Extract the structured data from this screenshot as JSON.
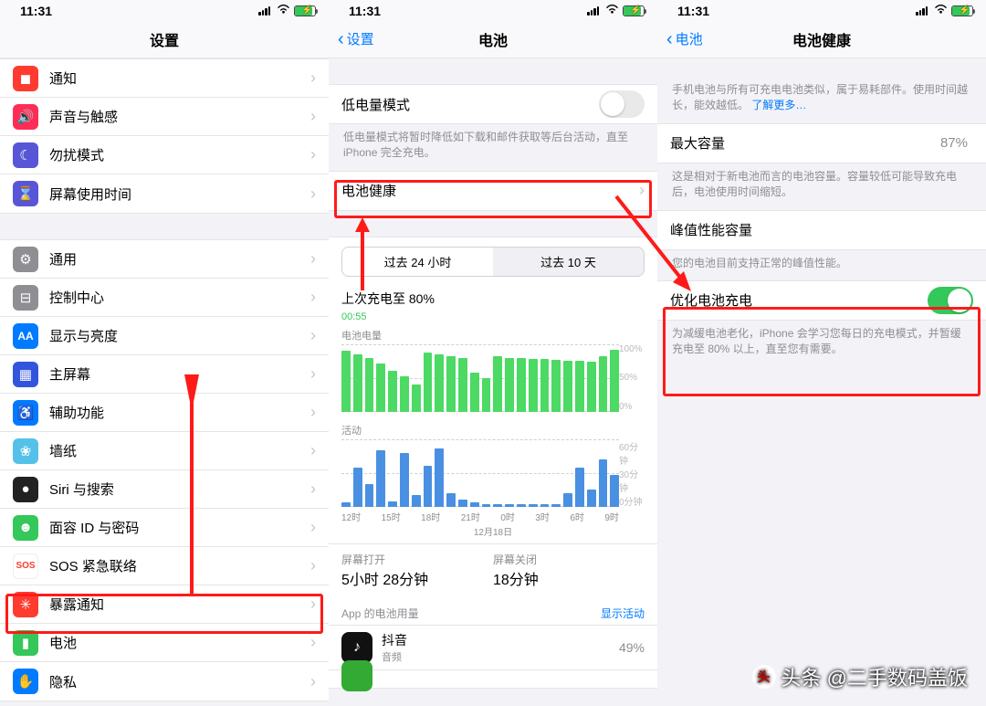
{
  "status": {
    "time": "11:31"
  },
  "s1": {
    "title": "设置",
    "section1": [
      {
        "label": "通知",
        "color": "#ff3b30",
        "glyph": "◼︎"
      },
      {
        "label": "声音与触感",
        "color": "#ff2d55",
        "glyph": "🔊"
      },
      {
        "label": "勿扰模式",
        "color": "#5856d6",
        "glyph": "☾"
      },
      {
        "label": "屏幕使用时间",
        "color": "#5856d6",
        "glyph": "⌛"
      }
    ],
    "section2": [
      {
        "label": "通用",
        "color": "#8e8e93",
        "glyph": "⚙"
      },
      {
        "label": "控制中心",
        "color": "#8e8e93",
        "glyph": "⊟"
      },
      {
        "label": "显示与亮度",
        "color": "#007aff",
        "glyph": "AA"
      },
      {
        "label": "主屏幕",
        "color": "#3355dd",
        "glyph": "▦"
      },
      {
        "label": "辅助功能",
        "color": "#007aff",
        "glyph": "♿"
      },
      {
        "label": "墙纸",
        "color": "#55c1e8",
        "glyph": "❀"
      },
      {
        "label": "Siri 与搜索",
        "color": "#222",
        "glyph": "●"
      },
      {
        "label": "面容 ID 与密码",
        "color": "#34c759",
        "glyph": "☻"
      },
      {
        "label": "SOS 紧急联络",
        "color": "#ffffff",
        "glyph": "SOS"
      },
      {
        "label": "暴露通知",
        "color": "#ff3b30",
        "glyph": "✳"
      },
      {
        "label": "电池",
        "color": "#34c759",
        "glyph": "▮"
      },
      {
        "label": "隐私",
        "color": "#007aff",
        "glyph": "✋"
      }
    ]
  },
  "s2": {
    "back": "设置",
    "title": "电池",
    "low_power": "低电量模式",
    "low_power_note": "低电量模式将暂时降低如下载和邮件获取等后台活动，直至 iPhone 完全充电。",
    "battery_health": "电池健康",
    "seg": {
      "a": "过去 24 小时",
      "b": "过去 10 天"
    },
    "last_charge": "上次充电至 80%",
    "last_charge_time": "00:55",
    "level_label": "电池电量",
    "activity_label": "活动",
    "ylabels_pct": [
      "100%",
      "50%",
      "0%"
    ],
    "ylabels_min": [
      "60分钟",
      "30分钟",
      "0分钟"
    ],
    "xaxis": [
      "12时",
      "15时",
      "18时",
      "21时",
      "0时",
      "3时",
      "6时",
      "9时"
    ],
    "xdate": "12月18日",
    "screen_on_k": "屏幕打开",
    "screen_on_v": "5小时 28分钟",
    "screen_off_k": "屏幕关闭",
    "screen_off_v": "18分钟",
    "apps_header": "App 的电池用量",
    "show_activity": "显示活动",
    "app1": {
      "name": "抖音",
      "sub": "音频",
      "pct": "49%"
    }
  },
  "s3": {
    "back": "电池",
    "title": "电池健康",
    "intro": "手机电池与所有可充电电池类似，属于易耗部件。使用时间越长，能效越低。",
    "learn_more": "了解更多…",
    "max_cap": "最大容量",
    "max_cap_val": "87%",
    "max_cap_note": "这是相对于新电池而言的电池容量。容量较低可能导致充电后，电池使用时间缩短。",
    "peak": "峰值性能容量",
    "peak_note": "您的电池目前支持正常的峰值性能。",
    "opt_title": "优化电池充电",
    "opt_note": "为减缓电池老化，iPhone 会学习您每日的充电模式，并暂缓充电至 80% 以上，直至您有需要。"
  },
  "watermark": "头条 @二手数码盖饭",
  "chart_data": [
    {
      "type": "bar",
      "title": "电池电量",
      "ylabel": "%",
      "ylim": [
        0,
        100
      ],
      "x": [
        "12",
        "13",
        "14",
        "15",
        "16",
        "17",
        "18",
        "19",
        "20",
        "21",
        "22",
        "23",
        "0",
        "1",
        "2",
        "3",
        "4",
        "5",
        "6",
        "7",
        "8",
        "9",
        "10",
        "11"
      ],
      "values": [
        90,
        85,
        80,
        72,
        60,
        52,
        40,
        88,
        85,
        82,
        80,
        58,
        50,
        82,
        80,
        79,
        78,
        78,
        77,
        76,
        75,
        74,
        82,
        92
      ]
    },
    {
      "type": "bar",
      "title": "活动",
      "ylabel": "分钟",
      "ylim": [
        0,
        60
      ],
      "x": [
        "12",
        "13",
        "14",
        "15",
        "16",
        "17",
        "18",
        "19",
        "20",
        "21",
        "22",
        "23",
        "0",
        "1",
        "2",
        "3",
        "4",
        "5",
        "6",
        "7",
        "8",
        "9",
        "10",
        "11"
      ],
      "values": [
        4,
        35,
        20,
        50,
        5,
        48,
        10,
        36,
        52,
        12,
        6,
        4,
        2,
        2,
        2,
        2,
        2,
        2,
        2,
        12,
        35,
        15,
        42,
        28
      ]
    }
  ]
}
